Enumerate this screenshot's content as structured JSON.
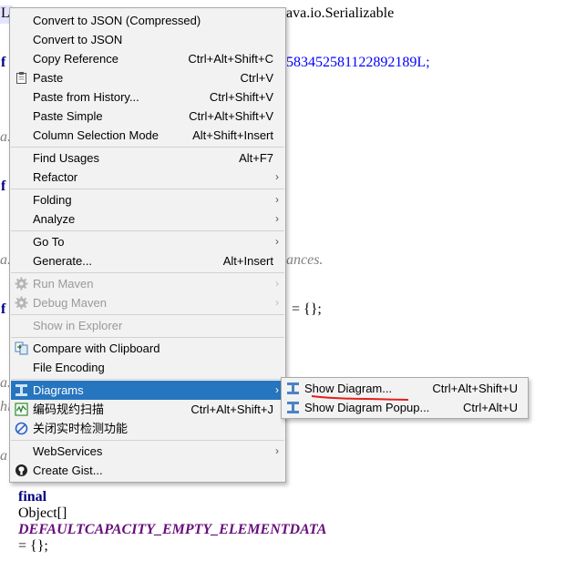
{
  "editor": {
    "line1_prefix": "L",
    "line1_tail": "ava.io.Serializable",
    "line2_prefix": "f",
    "line2_tail": "583452581122892189L;",
    "line3_prefix": "a.",
    "line4_prefix": "f",
    "line5_prefix": "a.",
    "line5_tail": "ances.",
    "line6_prefix": "f",
    "line6_tail": "= {};",
    "line7_prefix": "a.",
    "line8_prefix": "hi",
    "line9_prefix": "a",
    "last_kw": "final",
    "last_type": "Object[]",
    "last_const": "DEFAULTCAPACITY_EMPTY_ELEMENTDATA",
    "last_tail": "= {};"
  },
  "menu": {
    "items": [
      {
        "label": "Convert to JSON (Compressed)"
      },
      {
        "label": "Convert to JSON"
      },
      {
        "label": "Copy Reference",
        "shortcut": "Ctrl+Alt+Shift+C"
      },
      {
        "label": "Paste",
        "shortcut": "Ctrl+V",
        "icon": "clipboard-icon"
      },
      {
        "label": "Paste from History...",
        "shortcut": "Ctrl+Shift+V"
      },
      {
        "label": "Paste Simple",
        "shortcut": "Ctrl+Alt+Shift+V"
      },
      {
        "label": "Column Selection Mode",
        "shortcut": "Alt+Shift+Insert"
      },
      {
        "label": "Find Usages",
        "shortcut": "Alt+F7"
      },
      {
        "label": "Refactor"
      },
      {
        "label": "Folding"
      },
      {
        "label": "Analyze"
      },
      {
        "label": "Go To"
      },
      {
        "label": "Generate...",
        "shortcut": "Alt+Insert"
      },
      {
        "label": "Run Maven",
        "icon": "maven-gear-icon"
      },
      {
        "label": "Debug Maven",
        "icon": "maven-gear-icon"
      },
      {
        "label": "Show in Explorer"
      },
      {
        "label": "Compare with Clipboard",
        "icon": "compare-icon"
      },
      {
        "label": "File Encoding"
      },
      {
        "label": "Diagrams",
        "icon": "diagram-icon"
      },
      {
        "label": "编码规约扫描",
        "shortcut": "Ctrl+Alt+Shift+J",
        "icon": "scan-icon"
      },
      {
        "label": "关闭实时检测功能",
        "icon": "disable-icon"
      },
      {
        "label": "WebServices"
      },
      {
        "label": "Create Gist...",
        "icon": "github-icon"
      }
    ],
    "arrow": "›"
  },
  "submenu": {
    "items": [
      {
        "label": "Show Diagram...",
        "shortcut": "Ctrl+Alt+Shift+U",
        "icon": "diagram-icon"
      },
      {
        "label": "Show Diagram Popup...",
        "shortcut": "Ctrl+Alt+U",
        "icon": "diagram-icon"
      }
    ]
  },
  "colors": {
    "selection": "#2675bf",
    "annotation_underline": "#e0201c"
  }
}
